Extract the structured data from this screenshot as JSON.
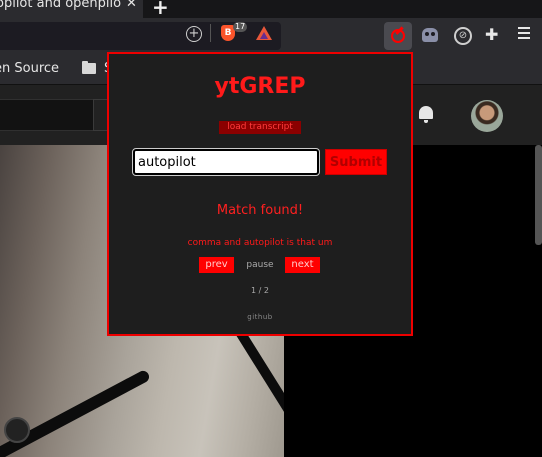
{
  "browser": {
    "tab_title": "opilot and openpilo",
    "tab_close": "✕",
    "new_tab": "+",
    "brave_shields_count": "17",
    "bookmarks": [
      "en Source",
      "S"
    ]
  },
  "popup": {
    "title": "ytGREP",
    "load_transcript_label": "load transcript",
    "search_value": "autopilot",
    "submit_label": "Submit",
    "status": "Match found!",
    "match_context": "comma and autopilot is that um",
    "prev_label": "prev",
    "pause_label": "pause",
    "next_label": "next",
    "counter": "1 / 2",
    "github_link": "github"
  },
  "colors": {
    "accent": "#ff0000",
    "popup_bg": "#1e1e1e",
    "toolbar_bg": "#2b2b2f"
  }
}
